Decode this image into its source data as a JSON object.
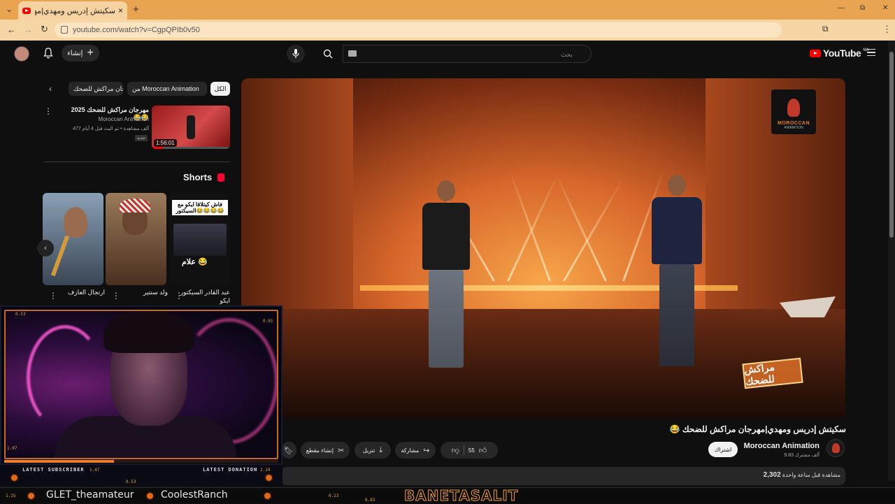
{
  "browser": {
    "tab_title": "سكيتش إدريس ومهدي|مهرجان مراكش للضحك",
    "url": "youtube.com/watch?v=CgpQPIb0v50",
    "new_tab": "+",
    "window_min": "—",
    "window_max": "⧉",
    "window_close": "✕"
  },
  "youtube": {
    "logo_text": "YouTube",
    "logo_country": "MA",
    "create_label": "إنشاء",
    "search_placeholder": "بحث",
    "chips": [
      "الكل",
      "من Moroccan Animation",
      "مهرجان مراكش للضحك"
    ],
    "recommended": {
      "title": "مهرجان مراكش للضحك 2025 😂😂",
      "channel": "Moroccan Animation",
      "meta": "477 ألف مشاهدة • تم البث قبل 4 أيام",
      "badge": "جديد",
      "duration": "1:56:01",
      "progress": 0.14
    },
    "shorts_heading": "Shorts",
    "shorts": [
      {
        "title": "عبد القادر السيكتور ايكو",
        "overlay_top": "فاش كيتلاقا ايكو مع السيكتور😂😂😂😂",
        "overlay_bottom": "علام 😂"
      },
      {
        "title": "ولد سنتير",
        "overlay_top": "",
        "overlay_bottom": ""
      },
      {
        "title": "ارتجال العازف",
        "overlay_top": "",
        "overlay_bottom": ""
      }
    ],
    "video": {
      "title": "سكيتش إدريس ومهدي|مهرجان مراكش للضحك 😂",
      "channel_badge_line1": "MOROCCAN",
      "channel_badge_line2": "ANIMATION",
      "show_logo_text": "مراكش للضحك"
    },
    "channel": {
      "name": "Moroccan Animation",
      "subs": "9.83 ألف مشترك",
      "subscribe": "اشتراك"
    },
    "actions": {
      "like_count": "55",
      "share": "مشاركة",
      "download": "تنزيل",
      "clip": "إنشاء مقطع"
    },
    "description": {
      "views": "2,302",
      "views_label": "مشاهدة",
      "time": "قبل ساعة واحدة"
    }
  },
  "stream_overlay": {
    "latest_subscriber_label": "LATEST SUBSCRIBER",
    "latest_donation_label": "LATEST DONATION",
    "subscriber_name": "GLET_theamateur",
    "donor_name": "CoolestRanch",
    "banner": "BANETASALIT",
    "cam_numbers": [
      "0.53",
      "0.01",
      "1.07",
      "1.47",
      "2.19",
      "0.53",
      "1.25",
      "0.23",
      "6.83"
    ]
  },
  "colors": {
    "tab_bar": "#e9a451",
    "yt_red": "#ff0000",
    "overlay_orange": "#e06a18"
  }
}
